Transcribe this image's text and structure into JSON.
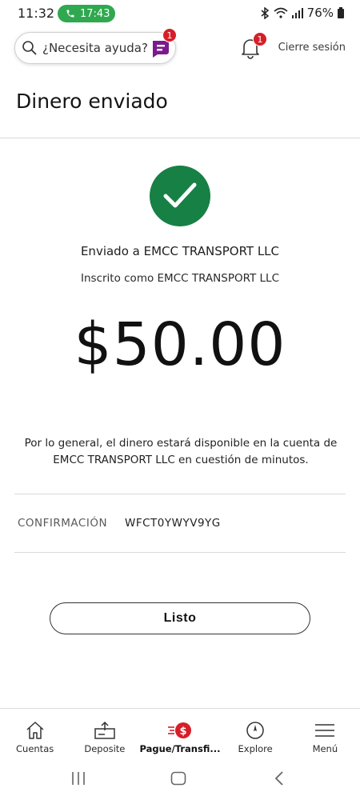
{
  "status_bar": {
    "time": "11:32",
    "call_time": "17:43",
    "battery": "76%"
  },
  "header": {
    "search_placeholder": "¿Necesita ayuda?",
    "assistant_badge_count": "1",
    "notifications_count": "1",
    "sign_out_label": "Cierre sesión"
  },
  "page": {
    "title": "Dinero enviado"
  },
  "confirmation": {
    "sent_to": "Enviado a EMCC TRANSPORT LLC",
    "enrolled_as": "Inscrito como EMCC TRANSPORT LLC",
    "amount": "$50.00",
    "availability_line1": "Por lo general, el dinero estará disponible en la cuenta de",
    "availability_line2": "EMCC TRANSPORT LLC en cuestión de minutos.",
    "confirmation_label": "CONFIRMACIÓN",
    "confirmation_number": "WFCT0YWYV9YG",
    "done_button": "Listo"
  },
  "bottom_nav": {
    "items": [
      {
        "label": "Cuentas",
        "icon": "house-icon"
      },
      {
        "label": "Deposite",
        "icon": "deposit-icon"
      },
      {
        "label": "Pague/Transfi...",
        "icon": "pay-transfer-icon",
        "active": true
      },
      {
        "label": "Explore",
        "icon": "compass-icon"
      },
      {
        "label": "Menú",
        "icon": "hamburger-icon"
      }
    ]
  },
  "colors": {
    "success_green": "#178045",
    "alert_red": "#d71e28",
    "call_green": "#2fa84f"
  }
}
